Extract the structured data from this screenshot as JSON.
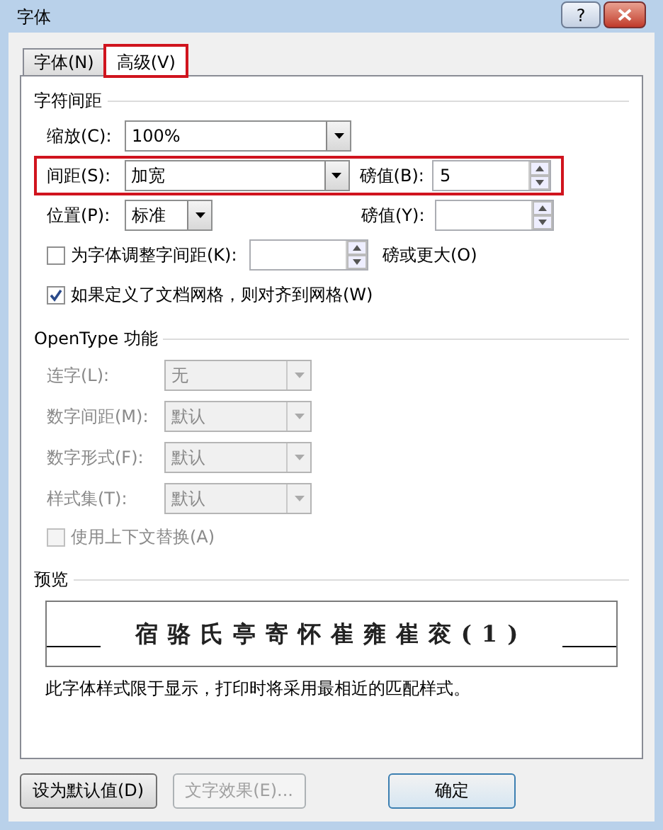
{
  "window": {
    "title": "字体",
    "help_button": "?"
  },
  "tabs": [
    {
      "label": "字体(N)",
      "selected": false,
      "highlighted": false
    },
    {
      "label": "高级(V)",
      "selected": true,
      "highlighted": true
    }
  ],
  "character_spacing": {
    "heading": "字符间距",
    "rows": [
      {
        "kind": "combo",
        "label": "缩放(C):",
        "value": "100%",
        "highlighted": false
      },
      {
        "kind": "combo_spin",
        "label": "间距(S):",
        "value": "加宽",
        "spin_label": "磅值(B):",
        "spin_value": "5",
        "highlighted": true
      },
      {
        "kind": "short_combo_spin",
        "label": "位置(P):",
        "value": "标准",
        "spin_label": "磅值(Y):",
        "highlighted": false
      },
      {
        "kind": "checkbox_spin",
        "label": "为字体调整字间距(K):",
        "checked": false,
        "suffix": "磅或更大(O)",
        "highlighted": false
      },
      {
        "kind": "checkbox",
        "label": "如果定义了文档网格，则对齐到网格(W)",
        "checked": true,
        "highlighted": false
      }
    ]
  },
  "opentype": {
    "heading": "OpenType 功能",
    "combos": [
      {
        "label": "连字(L):",
        "value": "无",
        "disabled": true
      },
      {
        "label": "数字间距(M):",
        "value": "默认",
        "disabled": true
      },
      {
        "label": "数字形式(F):",
        "value": "默认",
        "disabled": true
      },
      {
        "label": "样式集(T):",
        "value": "默认",
        "disabled": true
      }
    ],
    "contextual": {
      "label": "使用上下文替换(A)",
      "checked": false,
      "disabled": true
    }
  },
  "preview": {
    "heading": "预览",
    "sample": "宿骆氏亭寄怀崔雍崔衮(1)",
    "note": "此字体样式限于显示，打印时将采用最相近的匹配样式。"
  },
  "buttons": [
    {
      "label": "设为默认值(D)",
      "disabled": false,
      "default": false
    },
    {
      "label": "文字效果(E)...",
      "disabled": true,
      "default": false
    },
    {
      "label": "确定",
      "disabled": false,
      "default": true
    }
  ]
}
